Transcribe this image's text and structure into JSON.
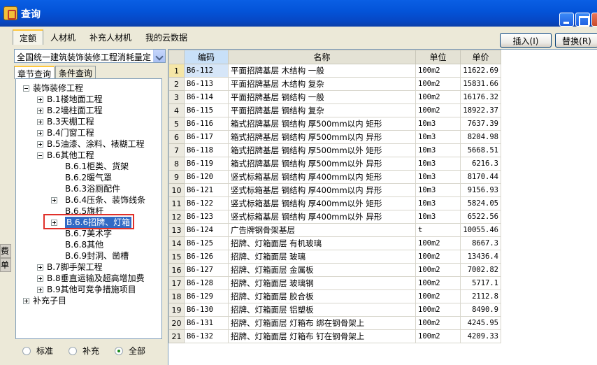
{
  "window": {
    "title": "查询"
  },
  "top_tabs": [
    "定额",
    "人材机",
    "补充人材机",
    "我的云数据"
  ],
  "buttons": {
    "insert": "插入(I)",
    "replace": "替换(R)"
  },
  "left": {
    "library_select": "全国统一建筑装饰装修工程消耗量定",
    "tabs": [
      "章节查询",
      "条件查询"
    ],
    "tree": [
      {
        "label": "装饰装修工程",
        "expander": "minus"
      },
      {
        "label": "B.1楼地面工程",
        "expander": "plus"
      },
      {
        "label": "B.2墙柱面工程",
        "expander": "plus"
      },
      {
        "label": "B.3天棚工程",
        "expander": "plus"
      },
      {
        "label": "B.4门窗工程",
        "expander": "plus"
      },
      {
        "label": "B.5油漆、涂料、裱糊工程",
        "expander": "plus"
      },
      {
        "label": "B.6其他工程",
        "expander": "minus"
      },
      {
        "label": "B.6.1柜类、货架",
        "expander": "none"
      },
      {
        "label": "B.6.2暖气罩",
        "expander": "none"
      },
      {
        "label": "B.6.3浴厕配件",
        "expander": "none"
      },
      {
        "label": "B.6.4压条、装饰线条",
        "expander": "plus"
      },
      {
        "label": "B.6.5旗杆",
        "expander": "none"
      },
      {
        "label": "B.6.6招牌、灯箱",
        "expander": "plus",
        "selected": true
      },
      {
        "label": "B.6.7美术字",
        "expander": "none"
      },
      {
        "label": "B.6.8其他",
        "expander": "none"
      },
      {
        "label": "B.6.9封洞、凿槽",
        "expander": "none"
      },
      {
        "label": "B.7脚手架工程",
        "expander": "plus"
      },
      {
        "label": "B.8垂直运输及超高增加费",
        "expander": "plus"
      },
      {
        "label": "B.9其他可竞争措施项目",
        "expander": "plus"
      },
      {
        "label": "补充子目",
        "expander": "plus"
      }
    ],
    "filters": [
      "标准",
      "补充",
      "全部"
    ],
    "selected_filter": "全部",
    "edge_labels": [
      "费用",
      "单位"
    ]
  },
  "grid": {
    "columns": [
      "编码",
      "名称",
      "单位",
      "单价"
    ],
    "rows": [
      [
        "1",
        "B6-112",
        "平面招牌基层 木结构 一般",
        "100m2",
        "11622.69"
      ],
      [
        "2",
        "B6-113",
        "平面招牌基层 木结构 复杂",
        "100m2",
        "15831.66"
      ],
      [
        "3",
        "B6-114",
        "平面招牌基层 钢结构 一般",
        "100m2",
        "16176.32"
      ],
      [
        "4",
        "B6-115",
        "平面招牌基层 钢结构 复杂",
        "100m2",
        "18922.37"
      ],
      [
        "5",
        "B6-116",
        "箱式招牌基层 钢结构 厚500mm以内 矩形",
        "10m3",
        "7637.39"
      ],
      [
        "6",
        "B6-117",
        "箱式招牌基层 钢结构 厚500mm以内 异形",
        "10m3",
        "8204.98"
      ],
      [
        "7",
        "B6-118",
        "箱式招牌基层 钢结构 厚500mm以外 矩形",
        "10m3",
        "5668.51"
      ],
      [
        "8",
        "B6-119",
        "箱式招牌基层 钢结构 厚500mm以外 异形",
        "10m3",
        "6216.3"
      ],
      [
        "9",
        "B6-120",
        "竖式标箱基层 钢结构 厚400mm以内 矩形",
        "10m3",
        "8170.44"
      ],
      [
        "10",
        "B6-121",
        "竖式标箱基层 钢结构 厚400mm以内 异形",
        "10m3",
        "9156.93"
      ],
      [
        "11",
        "B6-122",
        "竖式标箱基层 钢结构 厚400mm以外 矩形",
        "10m3",
        "5824.05"
      ],
      [
        "12",
        "B6-123",
        "竖式标箱基层 钢结构 厚400mm以外 异形",
        "10m3",
        "6522.56"
      ],
      [
        "13",
        "B6-124",
        "广告牌钢骨架基层",
        "t",
        "10055.46"
      ],
      [
        "14",
        "B6-125",
        "招牌、灯箱面层 有机玻璃",
        "100m2",
        "8667.3"
      ],
      [
        "15",
        "B6-126",
        "招牌、灯箱面层 玻璃",
        "100m2",
        "13436.4"
      ],
      [
        "16",
        "B6-127",
        "招牌、灯箱面层 金属板",
        "100m2",
        "7002.82"
      ],
      [
        "17",
        "B6-128",
        "招牌、灯箱面层 玻璃钢",
        "100m2",
        "5717.1"
      ],
      [
        "18",
        "B6-129",
        "招牌、灯箱面层 胶合板",
        "100m2",
        "2112.8"
      ],
      [
        "19",
        "B6-130",
        "招牌、灯箱面层 铝塑板",
        "100m2",
        "8490.9"
      ],
      [
        "20",
        "B6-131",
        "招牌、灯箱面层 灯箱布 绑在钢骨架上",
        "100m2",
        "4245.95"
      ],
      [
        "21",
        "B6-132",
        "招牌、灯箱面层 灯箱布 钉在钢骨架上",
        "100m2",
        "4209.33"
      ]
    ]
  }
}
